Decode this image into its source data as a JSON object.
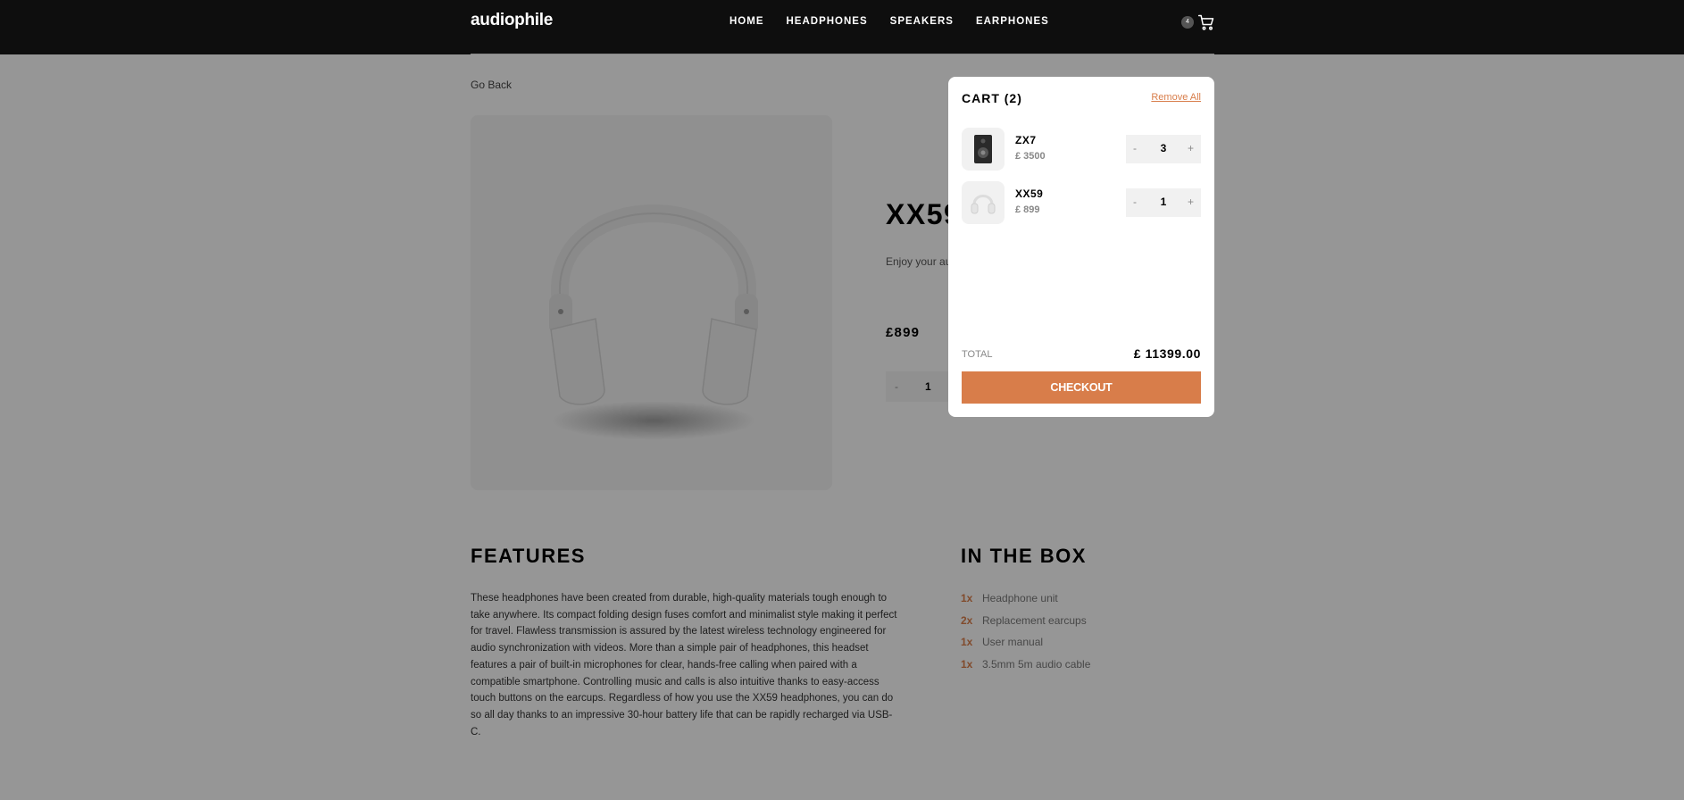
{
  "header": {
    "logo": "audiophile",
    "nav": [
      "HOME",
      "HEADPHONES",
      "SPEAKERS",
      "EARPHONES"
    ],
    "cart_count": "4",
    "cart_icon": "cart-icon"
  },
  "page": {
    "go_back": "Go Back",
    "product": {
      "title": "XX59",
      "description": "Enjoy your au… tastes with th… wireless head…",
      "price": "£899",
      "quantity": "1",
      "minus": "-"
    },
    "features": {
      "title": "FEATURES",
      "text": "These headphones have been created from durable, high-quality materials tough enough to take anywhere. Its compact folding design fuses comfort and minimalist style making it perfect for travel. Flawless transmission is assured by the latest wireless technology engineered for audio synchronization with videos. More than a simple pair of headphones, this headset features a pair of built-in microphones for clear, hands-free calling when paired with a compatible smartphone. Controlling music and calls is also intuitive thanks to easy-access touch buttons on the earcups. Regardless of how you use the XX59 headphones, you can do so all day thanks to an impressive 30-hour battery life that can be rapidly recharged via USB-C."
    },
    "in_the_box": {
      "title": "IN THE BOX",
      "items": [
        {
          "qty": "1x",
          "name": "Headphone unit"
        },
        {
          "qty": "2x",
          "name": "Replacement earcups"
        },
        {
          "qty": "1x",
          "name": "User manual"
        },
        {
          "qty": "1x",
          "name": "3.5mm 5m audio cable"
        }
      ]
    }
  },
  "cart": {
    "title": "CART (2)",
    "remove_all": "Remove All",
    "items": [
      {
        "name": "ZX7",
        "price": "£ 3500",
        "quantity": "3",
        "minus": "-",
        "plus": "+"
      },
      {
        "name": "XX59",
        "price": "£ 899",
        "quantity": "1",
        "minus": "-",
        "plus": "+"
      }
    ],
    "total_label": "TOTAL",
    "total_value": "£ 11399.00",
    "checkout": "CHECKOUT"
  },
  "colors": {
    "accent": "#d87d4a",
    "header_bg": "#0e0e0e"
  }
}
